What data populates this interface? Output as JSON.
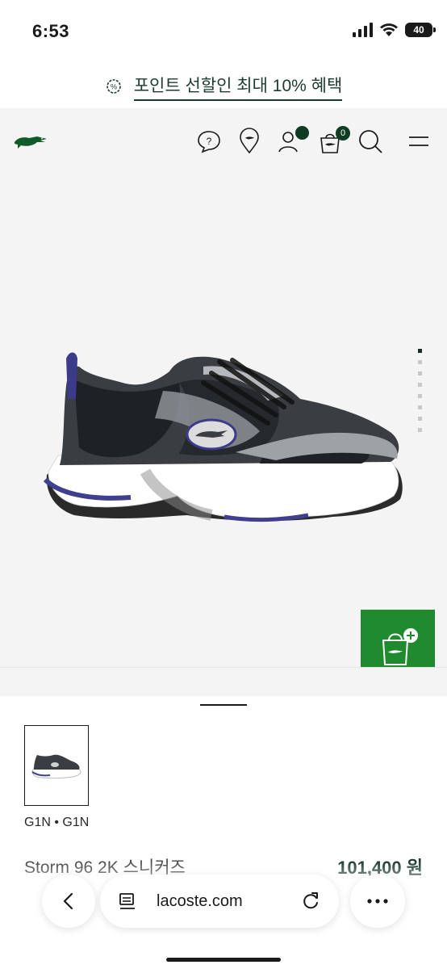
{
  "status": {
    "time": "6:53",
    "battery": "40",
    "icons": [
      "signal-icon",
      "wifi-icon",
      "battery-icon"
    ]
  },
  "promo": {
    "text": "포인트 선할인 최대 10% 혜택",
    "icon": "discount-badge-icon"
  },
  "header": {
    "logo": "crocodile-logo",
    "icons": [
      "help-icon",
      "store-locator-icon",
      "account-icon",
      "bag-icon",
      "search-icon",
      "menu-icon"
    ],
    "bag_count": "0"
  },
  "gallery": {
    "total_dots": 8,
    "active_dot": 0,
    "add_to_bag_icon": "add-to-bag-icon"
  },
  "product": {
    "color_code": "G1N • G1N",
    "name": "Storm 96 2K 스니커즈",
    "price": "101,400 원"
  },
  "browser": {
    "url": "lacoste.com",
    "icons": [
      "back-icon",
      "reader-icon",
      "reload-icon",
      "more-icon"
    ]
  },
  "colors": {
    "brand_green": "#1c3b2e",
    "add_button": "#1f8a2e",
    "hero_bg": "#f4f4f4"
  }
}
